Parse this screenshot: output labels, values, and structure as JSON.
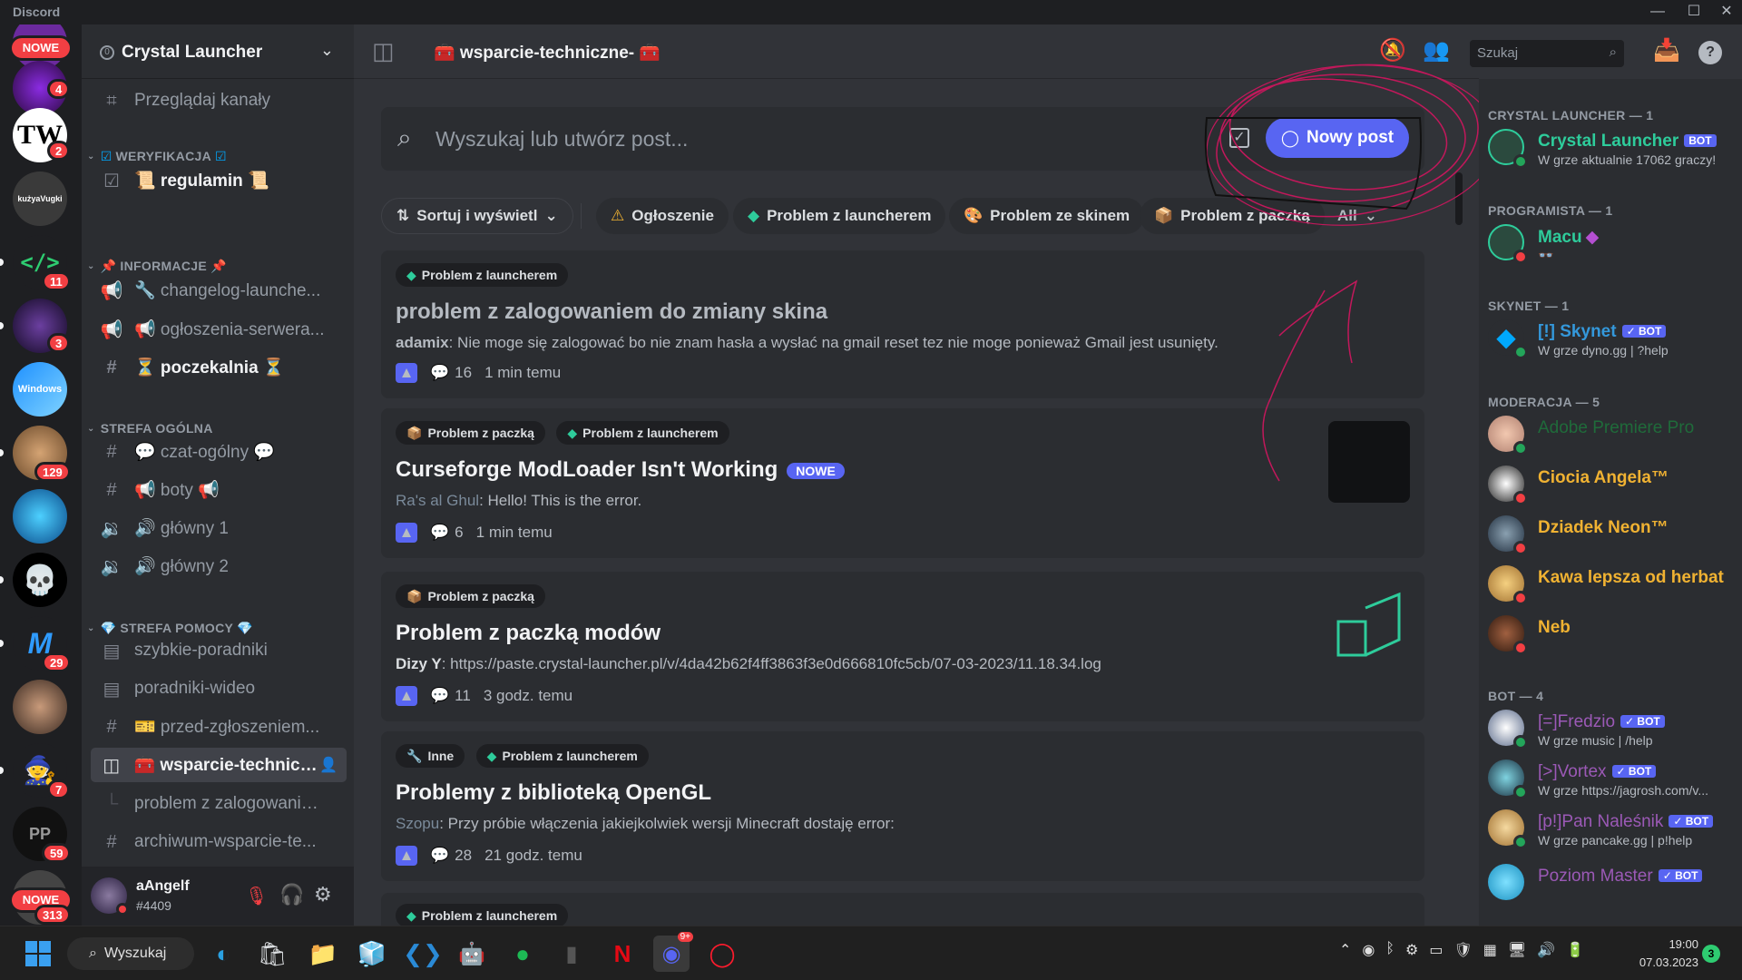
{
  "app": {
    "title": "Discord"
  },
  "rail": {
    "badges": {
      "s0": "4",
      "s1": "4",
      "s2": "2",
      "s4": "11",
      "s5": "3",
      "s7": "129",
      "s10": "29",
      "s12": "7",
      "s13": "59",
      "s14": "313"
    },
    "new_label": "NOWE",
    "new_label_bottom": "NOWE",
    "server_texts": {
      "tw": "TW",
      "kuzyn": "kużyaVugki",
      "code": "</>",
      "windows": "Windows"
    }
  },
  "guild": {
    "name": "Crystal Launcher",
    "browse": "Przeglądaj kanały",
    "categories": {
      "verify": "WERYFIKACJA",
      "info": "INFORMACJE",
      "general": "STREFA OGÓLNA",
      "help": "STREFA POMOCY"
    },
    "channels": {
      "regulamin": "📜 regulamin 📜",
      "changelog": "🔧 changelog-launche...",
      "ogloszenia": "📢 ogłoszenia-serwera...",
      "poczekalnia": "⏳ poczekalnia ⏳",
      "czat": "💬 czat-ogólny 💬",
      "boty": "📢 boty 📢",
      "glowny1": "🔊 główny 1",
      "glowny2": "🔊 główny 2",
      "szybkie": "szybkie-poradniki",
      "wideo": "poradniki-wideo",
      "przed": "🎫 przed-zgłoszeniem...",
      "wsparcie": "🧰 wsparcie-technicz...",
      "thread": "problem z zalogowaniem...",
      "archiwum": "archiwum-wsparcie-te..."
    }
  },
  "user": {
    "name": "aAngelf",
    "tag": "#4409"
  },
  "header": {
    "channel": "🧰 wsparcie-techniczne- 🧰",
    "search_placeholder": "Szukaj"
  },
  "forum": {
    "search_placeholder": "Wyszukaj lub utwórz post...",
    "new_post": "Nowy post",
    "sort": "Sortuj i wyświetl",
    "tags": [
      "Ogłoszenie",
      "Problem z launcherem",
      "Problem ze skinem",
      "Problem z paczką",
      "All"
    ]
  },
  "posts": [
    {
      "tags": [
        "Problem z launcherem"
      ],
      "title": "problem z zalogowaniem do zmiany skina",
      "author": "adamix",
      "excerpt": ": Nie moge się zalogować bo nie znam hasła a wysłać na gmail reset tez nie moge ponieważ Gmail jest usunięty.",
      "replies": "16",
      "time": "1 min temu"
    },
    {
      "tags": [
        "Problem z paczką",
        "Problem z launcherem"
      ],
      "title": "Curseforge ModLoader Isn't Working",
      "new": "NOWE",
      "author": "Ra's al Ghul",
      "excerpt": ": Hello! This is the error.",
      "replies": "6",
      "time": "1 min temu"
    },
    {
      "tags": [
        "Problem z paczką"
      ],
      "title": "Problem z paczką modów",
      "author": "Dizy Y",
      "excerpt": ": https://paste.crystal-launcher.pl/v/4da42b62f4ff3863f3e0d666810fc5cb/07-03-2023/11.18.34.log",
      "replies": "11",
      "time": "3 godz. temu"
    },
    {
      "tags": [
        "Inne",
        "Problem z launcherem"
      ],
      "title": "Problemy z biblioteką OpenGL",
      "author": "Szopu",
      "excerpt": ": Przy próbie włączenia jakiejkolwiek wersji Minecraft dostaję error:",
      "replies": "28",
      "time": "21 godz. temu"
    },
    {
      "tags": [
        "Problem z launcherem"
      ]
    }
  ],
  "members": {
    "groups": [
      "CRYSTAL LAUNCHER — 1",
      "PROGRAMISTA — 1",
      "SKYNET — 1",
      "MODERACJA — 5",
      "BOT — 4"
    ],
    "list": [
      {
        "name": "Crystal Launcher",
        "sub": "W grze aktualnie 17062 graczy!",
        "bot": "BOT"
      },
      {
        "name": "Macu",
        "sub": "👓"
      },
      {
        "name": "[!] Skynet",
        "sub": "W grze dyno.gg | ?help",
        "bot": "✓ BOT"
      },
      {
        "name": "Adobe Premiere Pro"
      },
      {
        "name": "Ciocia Angela™"
      },
      {
        "name": "Dziadek Neon™"
      },
      {
        "name": "Kawa lepsza od herbat"
      },
      {
        "name": "Neb"
      },
      {
        "name": "[=]Fredzio",
        "sub": "W grze music | /help",
        "bot": "✓ BOT"
      },
      {
        "name": "[>]Vortex",
        "sub": "W grze https://jagrosh.com/v...",
        "bot": "✓ BOT"
      },
      {
        "name": "[p!]Pan Naleśnik",
        "sub": "W grze pancake.gg | p!help",
        "bot": "✓ BOT"
      },
      {
        "name": "Poziom Master",
        "bot": "✓ BOT"
      }
    ]
  },
  "taskbar": {
    "search": "Wyszukaj",
    "time": "19:00",
    "date": "07.03.2023",
    "notif": "3",
    "discord_badge": "9+"
  },
  "colors": {
    "accent": "#5865f2",
    "online": "#23a55a",
    "dnd": "#f23f43",
    "crystal_role": "#2ecc9b",
    "admin_role": "#f0b232",
    "bot_role": "#9b59b6",
    "annotation": "#c2185b"
  }
}
